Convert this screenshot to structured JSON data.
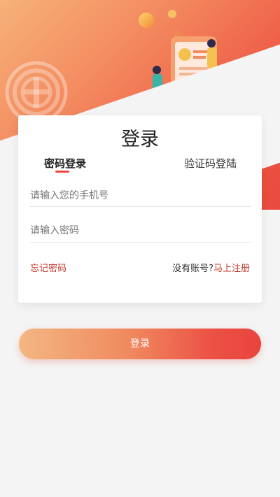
{
  "card": {
    "title": "登录",
    "tabs": [
      {
        "label": "密码登录",
        "active": true
      },
      {
        "label": "验证码登陆",
        "active": false
      }
    ],
    "phone_placeholder": "请输入您的手机号",
    "password_placeholder": "请输入密码",
    "forgot_label": "忘记密码",
    "no_account_label": "没有账号?",
    "register_label": "马上注册"
  },
  "login_button_label": "登录",
  "colors": {
    "accent": "#e9473b",
    "link": "#c0392b",
    "hero_start": "#f7b27a",
    "hero_end": "#e94a3e"
  },
  "icons": [
    "union-emblem-icon",
    "hero-illustration"
  ]
}
